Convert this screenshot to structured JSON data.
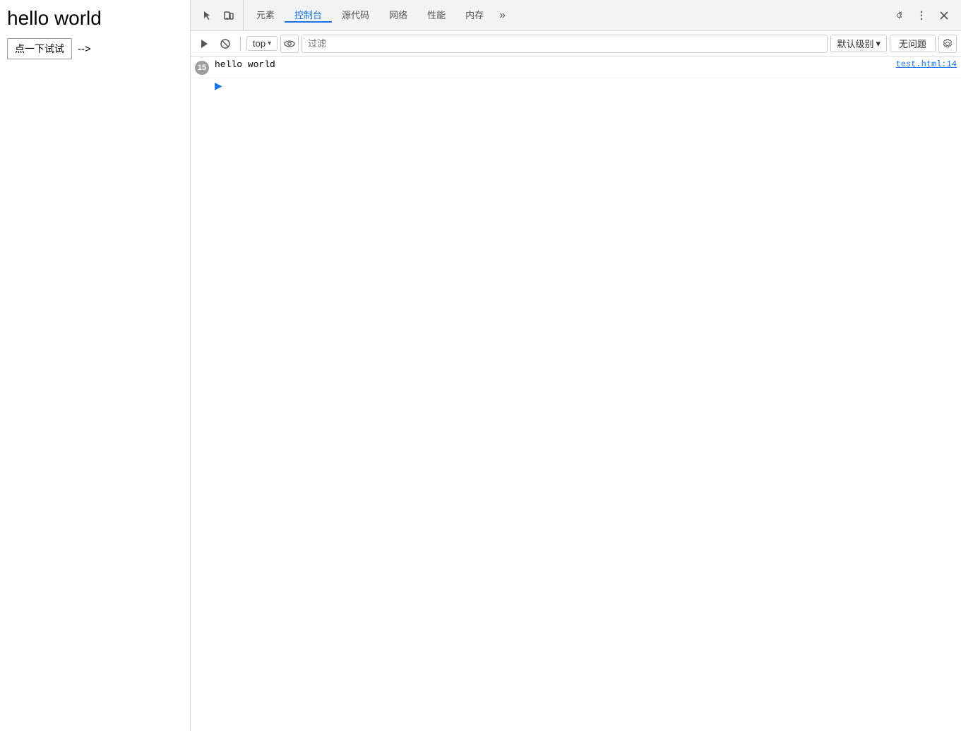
{
  "webpage": {
    "title": "hello world",
    "button_label": "点一下试试",
    "arrow": "-->"
  },
  "devtools": {
    "tabs": [
      {
        "id": "elements",
        "label": "元素",
        "active": false
      },
      {
        "id": "console",
        "label": "控制台",
        "active": true
      },
      {
        "id": "sources",
        "label": "源代码",
        "active": false
      },
      {
        "id": "network",
        "label": "网络",
        "active": false
      },
      {
        "id": "performance",
        "label": "性能",
        "active": false
      },
      {
        "id": "memory",
        "label": "内存",
        "active": false
      }
    ],
    "more_tabs_icon": "»",
    "console": {
      "context": "top",
      "filter_placeholder": "过滤",
      "level_label": "默认级别",
      "no_issues_label": "无问题",
      "log_entry": {
        "count": "15",
        "message": "hello world",
        "source": "test.html:14"
      }
    }
  }
}
